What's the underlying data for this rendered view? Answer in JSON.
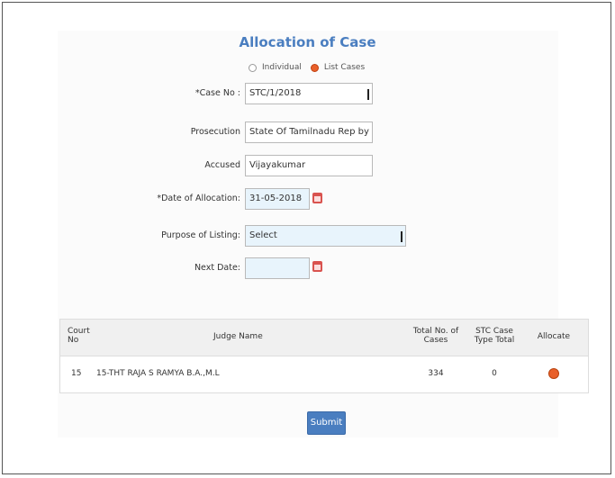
{
  "title": "Allocation of Case",
  "case_type": {
    "options": [
      "Individual",
      "List Cases"
    ],
    "selected": "List Cases"
  },
  "form": {
    "case_no": {
      "label": "*Case No :",
      "value": "STC/1/2018"
    },
    "prosecution": {
      "label": "Prosecution",
      "value": "State Of Tamilnadu Rep by St"
    },
    "accused": {
      "label": "Accused",
      "value": "Vijayakumar"
    },
    "date_of_allocation": {
      "label": "*Date of Allocation:",
      "value": "31-05-2018"
    },
    "purpose_of_listing": {
      "label": "Purpose of Listing:",
      "value": "Select"
    },
    "next_date": {
      "label": "Next Date:",
      "value": ""
    }
  },
  "table": {
    "headers": {
      "court_no": "Court No",
      "judge_name": "Judge Name",
      "total_cases": "Total No. of Cases",
      "stc_case_type": "STC Case Type Total",
      "allocate": "Allocate"
    },
    "rows": [
      {
        "court_no": "15",
        "judge_name": "15-THT RAJA S RAMYA B.A.,M.L",
        "total_cases": "334",
        "stc_case_type": "0"
      }
    ]
  },
  "submit_label": "Submit",
  "colors": {
    "accent": "#4a7ec0",
    "radio_selected": "#e9602a",
    "field_highlight": "#e8f4fc"
  }
}
